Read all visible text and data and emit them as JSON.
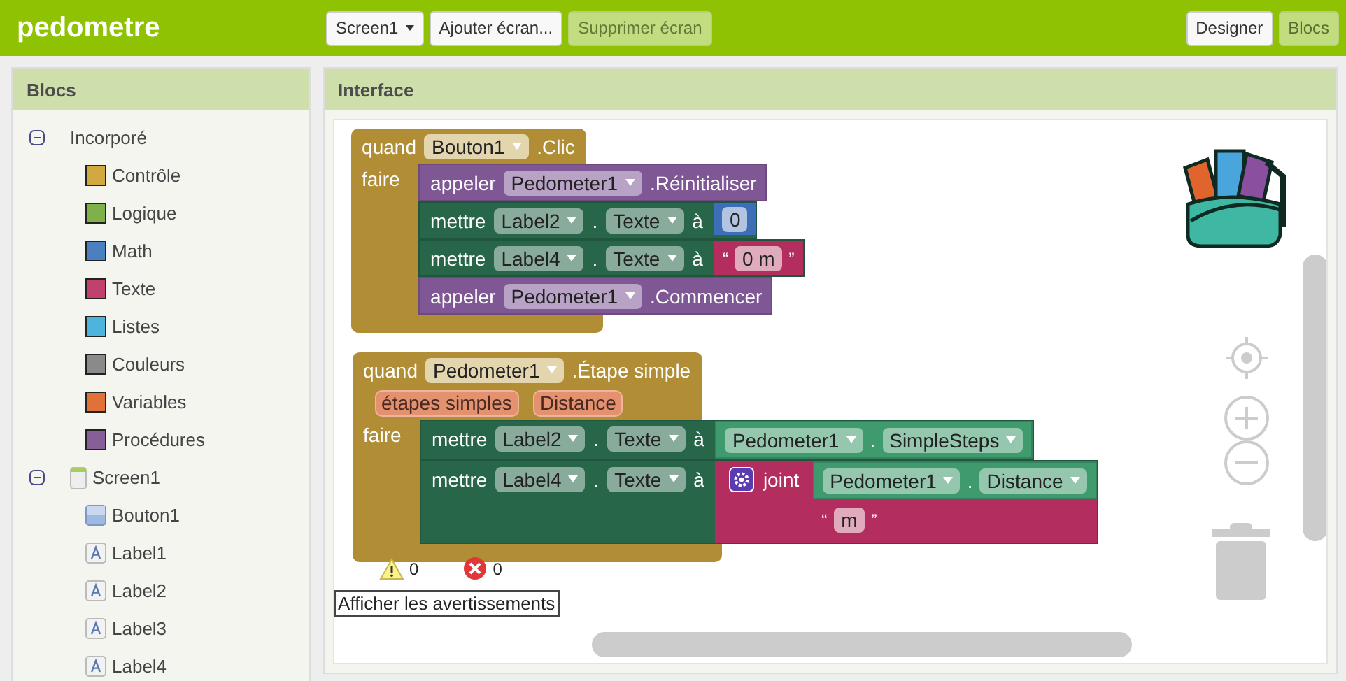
{
  "app_title": "pedometre",
  "screen_menu": {
    "label": "Screen1"
  },
  "toolbar_buttons": [
    {
      "label": "Ajouter écran...",
      "disabled": false
    },
    {
      "label": "Supprimer écran",
      "disabled": true
    }
  ],
  "view_buttons": [
    {
      "label": "Designer",
      "selected": false
    },
    {
      "label": "Blocs",
      "selected": true
    }
  ],
  "sidebar": {
    "title": "Blocs",
    "tree": [
      {
        "label": "Incorporé",
        "kind": "group",
        "expanded": true,
        "children": [
          {
            "label": "Contrôle",
            "kind": "category",
            "color": "#d1a940"
          },
          {
            "label": "Logique",
            "kind": "category",
            "color": "#80b049"
          },
          {
            "label": "Math",
            "kind": "category",
            "color": "#4a7fc0"
          },
          {
            "label": "Texte",
            "kind": "category",
            "color": "#c0426c"
          },
          {
            "label": "Listes",
            "kind": "category",
            "color": "#4cb4dd"
          },
          {
            "label": "Couleurs",
            "kind": "category",
            "color": "#8a8a8a"
          },
          {
            "label": "Variables",
            "kind": "category",
            "color": "#e07138"
          },
          {
            "label": "Procédures",
            "kind": "category",
            "color": "#875f98"
          }
        ]
      },
      {
        "label": "Screen1",
        "kind": "screen",
        "expanded": true,
        "children": [
          {
            "label": "Bouton1",
            "kind": "button"
          },
          {
            "label": "Label1",
            "kind": "label"
          },
          {
            "label": "Label2",
            "kind": "label"
          },
          {
            "label": "Label3",
            "kind": "label"
          },
          {
            "label": "Label4",
            "kind": "label"
          }
        ]
      }
    ]
  },
  "workspace": {
    "title": "Interface",
    "blocks": [
      {
        "kind": "event",
        "keyword": "quand",
        "component": "Bouton1",
        "event": ".Clic",
        "do_label": "faire",
        "statements": [
          {
            "kind": "call",
            "keyword": "appeler",
            "component": "Pedometer1",
            "method": ".Réinitialiser"
          },
          {
            "kind": "set",
            "keyword": "mettre",
            "component": "Label2",
            "dot": ".",
            "property": "Texte",
            "to": "à",
            "value": {
              "kind": "number",
              "text": "0"
            }
          },
          {
            "kind": "set",
            "keyword": "mettre",
            "component": "Label4",
            "dot": ".",
            "property": "Texte",
            "to": "à",
            "value": {
              "kind": "text",
              "open": "“",
              "text": "0 m",
              "close": "”"
            }
          },
          {
            "kind": "call",
            "keyword": "appeler",
            "component": "Pedometer1",
            "method": ".Commencer"
          }
        ]
      },
      {
        "kind": "event",
        "keyword": "quand",
        "component": "Pedometer1",
        "event": ".Étape simple",
        "params": [
          "étapes simples",
          "Distance"
        ],
        "do_label": "faire",
        "statements": [
          {
            "kind": "set",
            "keyword": "mettre",
            "component": "Label2",
            "dot": ".",
            "property": "Texte",
            "to": "à",
            "value": {
              "kind": "getter",
              "component": "Pedometer1",
              "dot": ".",
              "property": "SimpleSteps"
            }
          },
          {
            "kind": "set",
            "keyword": "mettre",
            "component": "Label4",
            "dot": ".",
            "property": "Texte",
            "to": "à",
            "value": {
              "kind": "join",
              "label": "joint",
              "items": [
                {
                  "kind": "getter",
                  "component": "Pedometer1",
                  "dot": ".",
                  "property": "Distance"
                },
                {
                  "kind": "text",
                  "open": "“",
                  "text": "m",
                  "close": "”"
                }
              ]
            }
          }
        ]
      }
    ],
    "warning_count": "0",
    "error_count": "0",
    "show_warnings": "Afficher les avertissements"
  }
}
